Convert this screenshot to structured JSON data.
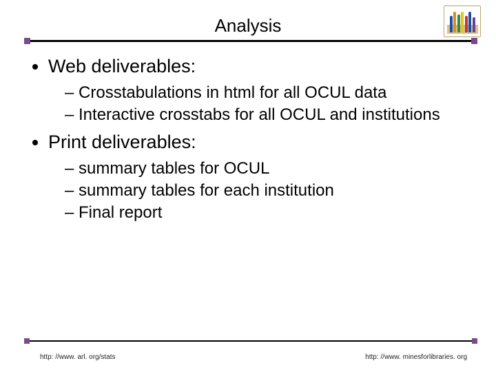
{
  "title": "Analysis",
  "bullets": [
    {
      "label": "Web deliverables:",
      "sub": [
        "Crosstabulations in html for all OCUL data",
        "Interactive crosstabs for all OCUL and institutions"
      ]
    },
    {
      "label": "Print deliverables:",
      "sub": [
        "summary tables for OCUL",
        "summary tables for each institution",
        "Final report"
      ]
    }
  ],
  "footer": {
    "left": "http: //www. arl. org/stats",
    "right": "http: //www. minesforlibraries. org"
  }
}
